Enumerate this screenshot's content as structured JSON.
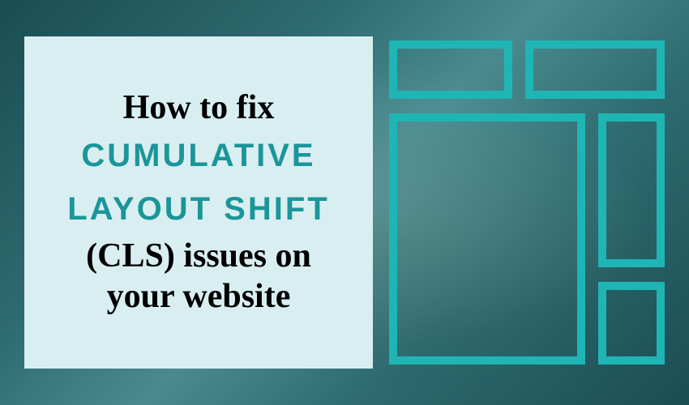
{
  "title": {
    "line1": "How to fix",
    "highlight1": "CUMULATIVE",
    "highlight2": "LAYOUT SHIFT",
    "line2": "(CLS) issues on",
    "line3": "your website"
  },
  "colors": {
    "accent": "#1fb5b5",
    "highlightText": "#1a9699",
    "boxBackground": "#d9eef1"
  }
}
